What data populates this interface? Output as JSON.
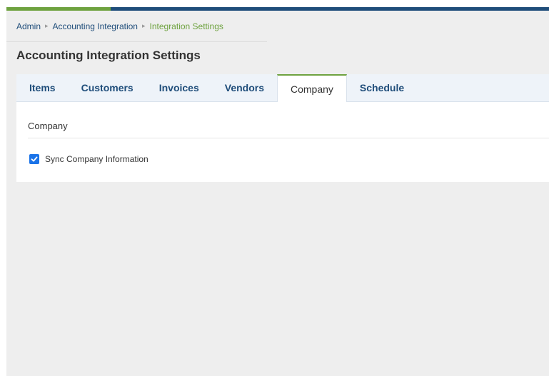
{
  "breadcrumb": {
    "items": [
      "Admin",
      "Accounting Integration",
      "Integration Settings"
    ],
    "separator": "▸"
  },
  "page": {
    "title": "Accounting Integration Settings"
  },
  "tabs": [
    {
      "label": "Items",
      "active": false
    },
    {
      "label": "Customers",
      "active": false
    },
    {
      "label": "Invoices",
      "active": false
    },
    {
      "label": "Vendors",
      "active": false
    },
    {
      "label": "Company",
      "active": true
    },
    {
      "label": "Schedule",
      "active": false
    }
  ],
  "panel": {
    "section_title": "Company",
    "sync_checkbox": {
      "label": "Sync Company Information",
      "checked": true
    }
  },
  "colors": {
    "brand_blue": "#1f4d7a",
    "brand_green": "#6ea23f",
    "checkbox_blue": "#1a73e8"
  }
}
